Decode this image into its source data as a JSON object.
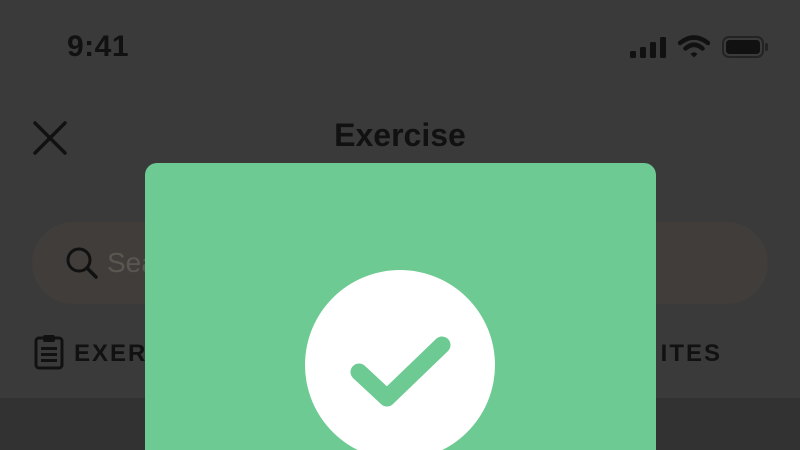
{
  "status_bar": {
    "time": "9:41",
    "icons": [
      "signal-icon",
      "wifi-icon",
      "battery-icon"
    ]
  },
  "header": {
    "title": "Exercise",
    "close_icon": "close-icon"
  },
  "search": {
    "placeholder": "Sea",
    "icon": "search-icon"
  },
  "tabs": [
    {
      "label": "EXER",
      "icon": "clipboard-icon"
    },
    {
      "label": "ITES"
    }
  ],
  "modal": {
    "icon": "checkmark-icon",
    "color": "#6dca92"
  },
  "colors": {
    "overlay_background": "#3a3a3a",
    "success_green": "#6dca92"
  }
}
